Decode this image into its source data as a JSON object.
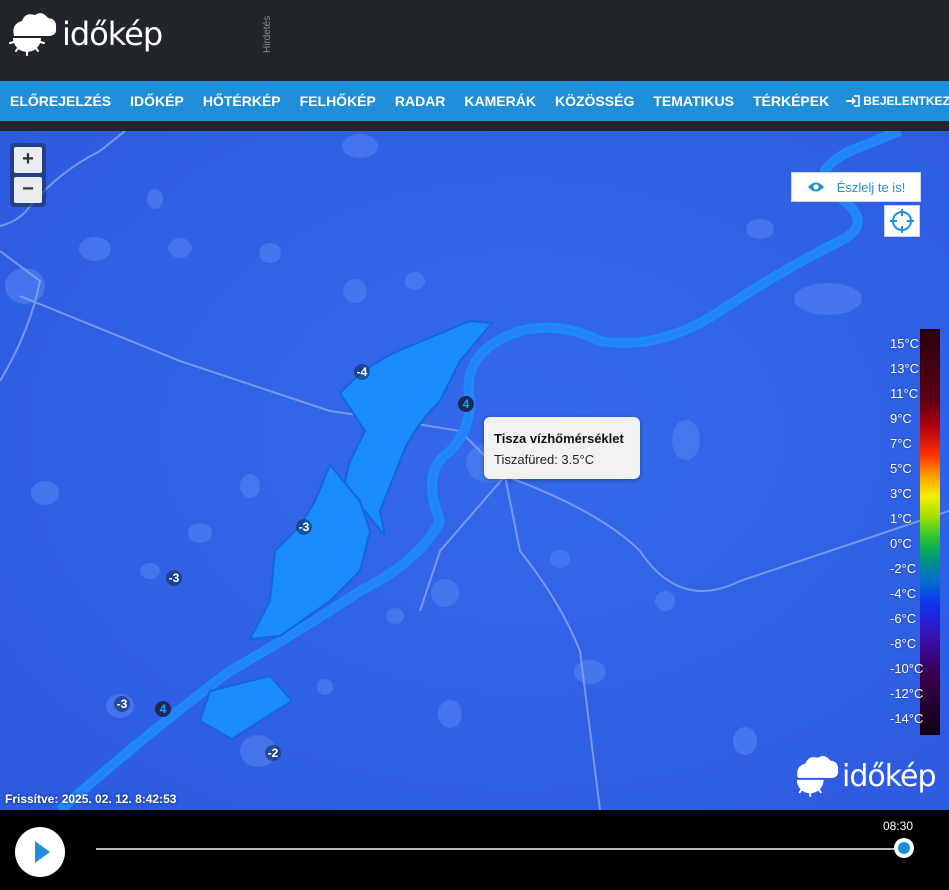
{
  "header": {
    "logo_text": "időkép",
    "ad_label": "Hirdetés"
  },
  "nav": {
    "items": [
      "ELŐREJELZÉS",
      "IDŐKÉP",
      "HŐTÉRKÉP",
      "FELHŐKÉP",
      "RADAR",
      "KAMERÁK",
      "KÖZÖSSÉG",
      "TEMATIKUS",
      "TÉRKÉPEK"
    ],
    "login_label": "BEJELENTKEZÉS"
  },
  "map": {
    "zoom_in": "+",
    "zoom_out": "−",
    "observe_label": "Észlelj te is!",
    "tooltip": {
      "title": "Tisza vízhőmérséklet",
      "body": "Tiszafüred: 3.5°C"
    },
    "air_markers": [
      "-4",
      "-3",
      "-3",
      "-3",
      "-2"
    ],
    "river_markers": [
      "4",
      "4"
    ],
    "watermark_text": "időkép",
    "updated_text": "Frissítve: 2025. 02. 12. 8:42:53"
  },
  "legend": {
    "labels": [
      "15°C",
      "13°C",
      "11°C",
      "9°C",
      "7°C",
      "5°C",
      "3°C",
      "1°C",
      "0°C",
      "-2°C",
      "-4°C",
      "-6°C",
      "-8°C",
      "-10°C",
      "-12°C",
      "-14°C"
    ]
  },
  "player": {
    "time_label": "08:30",
    "progress": 1.0
  },
  "colors": {
    "accent": "#1e8fd8",
    "map_background": "#2f61e6",
    "river": "#1e8fff",
    "header_bg": "#222529"
  }
}
